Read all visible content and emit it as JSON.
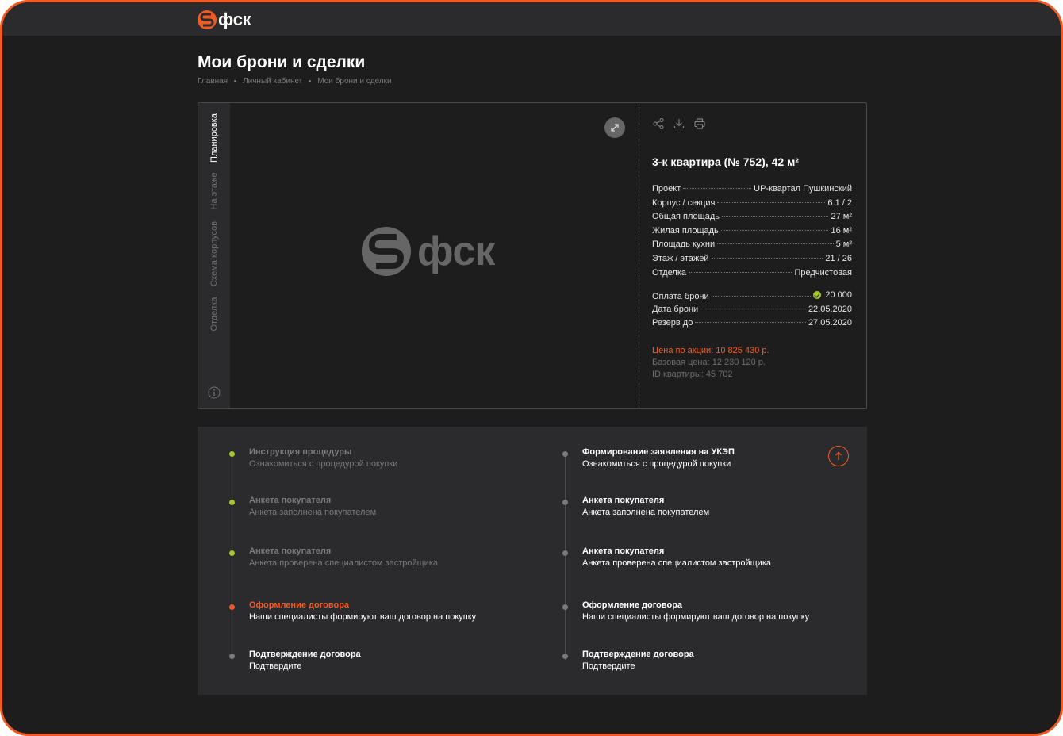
{
  "brand": {
    "name": "фск",
    "accent": "#f15a24"
  },
  "page": {
    "title": "Мои брони и сделки",
    "breadcrumbs": [
      "Главная",
      "Личный кабинет",
      "Мои брони и сделки"
    ]
  },
  "tabs": [
    {
      "label": "Планировка",
      "active": true
    },
    {
      "label": "На этаже",
      "active": false
    },
    {
      "label": "Схема корпусов",
      "active": false
    },
    {
      "label": "Отделка",
      "active": false
    }
  ],
  "icons": {
    "info": "info-icon",
    "expand": "expand-icon",
    "share": "share-icon",
    "download": "download-icon",
    "print": "print-icon",
    "scroll_up": "arrow-up-icon"
  },
  "flat": {
    "title": "3-к квартира (№ 752), 42 м²",
    "specs": [
      {
        "label": "Проект",
        "value": "UP-квартал Пушкинский"
      },
      {
        "label": "Корпус / секция",
        "value": "6.1 / 2"
      },
      {
        "label": "Общая площадь",
        "value": "27 м²"
      },
      {
        "label": "Жилая площадь",
        "value": "16 м²"
      },
      {
        "label": "Площадь кухни",
        "value": "5 м²"
      },
      {
        "label": "Этаж / этажей",
        "value": "21 / 26"
      },
      {
        "label": "Отделка",
        "value": "Предчистовая"
      }
    ],
    "booking": [
      {
        "label": "Оплата брони",
        "value": "20 000",
        "paid": true
      },
      {
        "label": "Дата брони",
        "value": "22.05.2020"
      },
      {
        "label": "Резерв до",
        "value": "27.05.2020"
      }
    ],
    "price_promo": "Цена по акции: 10 825 430 р.",
    "price_base": "Базовая цена: 12 230 120 р.",
    "flat_id": "ID квартиры: 45 702"
  },
  "steps_left": [
    {
      "title": "Инструкция процедуры",
      "subtitle": "Ознакомиться с процедурой покупки",
      "status": "done"
    },
    {
      "title": "Анкета покупателя",
      "subtitle": "Анкета заполнена покупателем",
      "status": "done"
    },
    {
      "title": "Анкета покупателя",
      "subtitle": "Анкета проверена специалистом застройщика",
      "status": "done"
    },
    {
      "title": "Оформление договора",
      "subtitle": "Наши специалисты формируют ваш договор на покупку",
      "status": "current"
    },
    {
      "title": "Подтверждение договора",
      "subtitle": "Подтвердите",
      "status": "pending"
    }
  ],
  "steps_right": [
    {
      "title": "Формирование заявления на УКЭП",
      "subtitle": "Ознакомиться с процедурой покупки",
      "status": "pending"
    },
    {
      "title": "Анкета покупателя",
      "subtitle": "Анкета заполнена покупателем",
      "status": "pending"
    },
    {
      "title": "Анкета покупателя",
      "subtitle": "Анкета проверена специалистом застройщика",
      "status": "pending"
    },
    {
      "title": "Оформление договора",
      "subtitle": "Наши специалисты формируют ваш договор на покупку",
      "status": "pending"
    },
    {
      "title": "Подтверждение договора",
      "subtitle": "Подтвердите",
      "status": "pending"
    }
  ],
  "colors": {
    "done": "#a3c62a",
    "current": "#f15a24",
    "pending": "#7a7a7a"
  }
}
